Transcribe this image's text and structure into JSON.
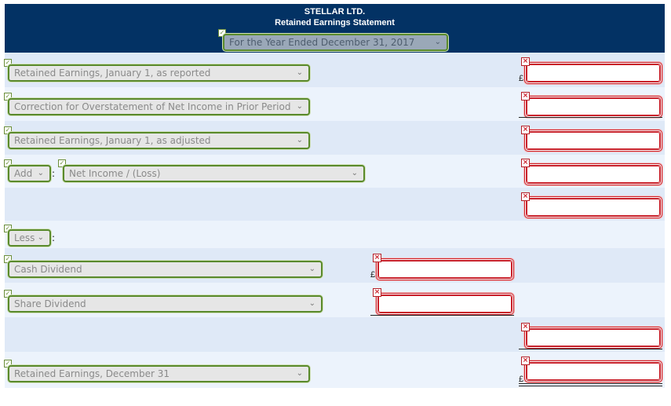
{
  "header": {
    "company": "STELLAR LTD.",
    "title": "Retained Earnings Statement",
    "period": "For the Year Ended December 31, 2017"
  },
  "icons": {
    "chevron": "⌄",
    "check": "✓",
    "cross": "×"
  },
  "currency_symbol": "£",
  "colors": {
    "header_bg": "#033264",
    "correct_border": "#5a8a2c",
    "incorrect_border": "#c8202a",
    "row_dark": "#dfe9f7",
    "row_light": "#ecf3fc"
  },
  "rows": [
    {
      "label": "Retained Earnings, January 1, as reported",
      "label_status": "correct",
      "amount": "",
      "amount_status": "incorrect",
      "currency": true
    },
    {
      "label": "Correction for Overstatement of Net Income in Prior Period",
      "label_status": "correct",
      "amount": "",
      "amount_status": "incorrect"
    },
    {
      "label": "Retained Earnings, January 1, as adjusted",
      "label_status": "correct",
      "amount": "",
      "amount_status": "incorrect"
    },
    {
      "prefix": "Add",
      "label": "Net Income / (Loss)",
      "label_status": "correct",
      "amount": "",
      "amount_status": "incorrect"
    },
    {
      "amount": "",
      "amount_status": "incorrect"
    },
    {
      "prefix": "Less",
      "label_status": "correct"
    },
    {
      "label": "Cash Dividend",
      "label_status": "correct",
      "amount": "",
      "amount_status": "incorrect",
      "currency": true
    },
    {
      "label": "Share Dividend",
      "label_status": "correct",
      "amount": "",
      "amount_status": "incorrect"
    },
    {
      "amount": "",
      "amount_status": "incorrect"
    },
    {
      "label": "Retained Earnings, December 31",
      "label_status": "correct",
      "amount": "",
      "amount_status": "incorrect",
      "currency": true
    }
  ],
  "colon": ":"
}
